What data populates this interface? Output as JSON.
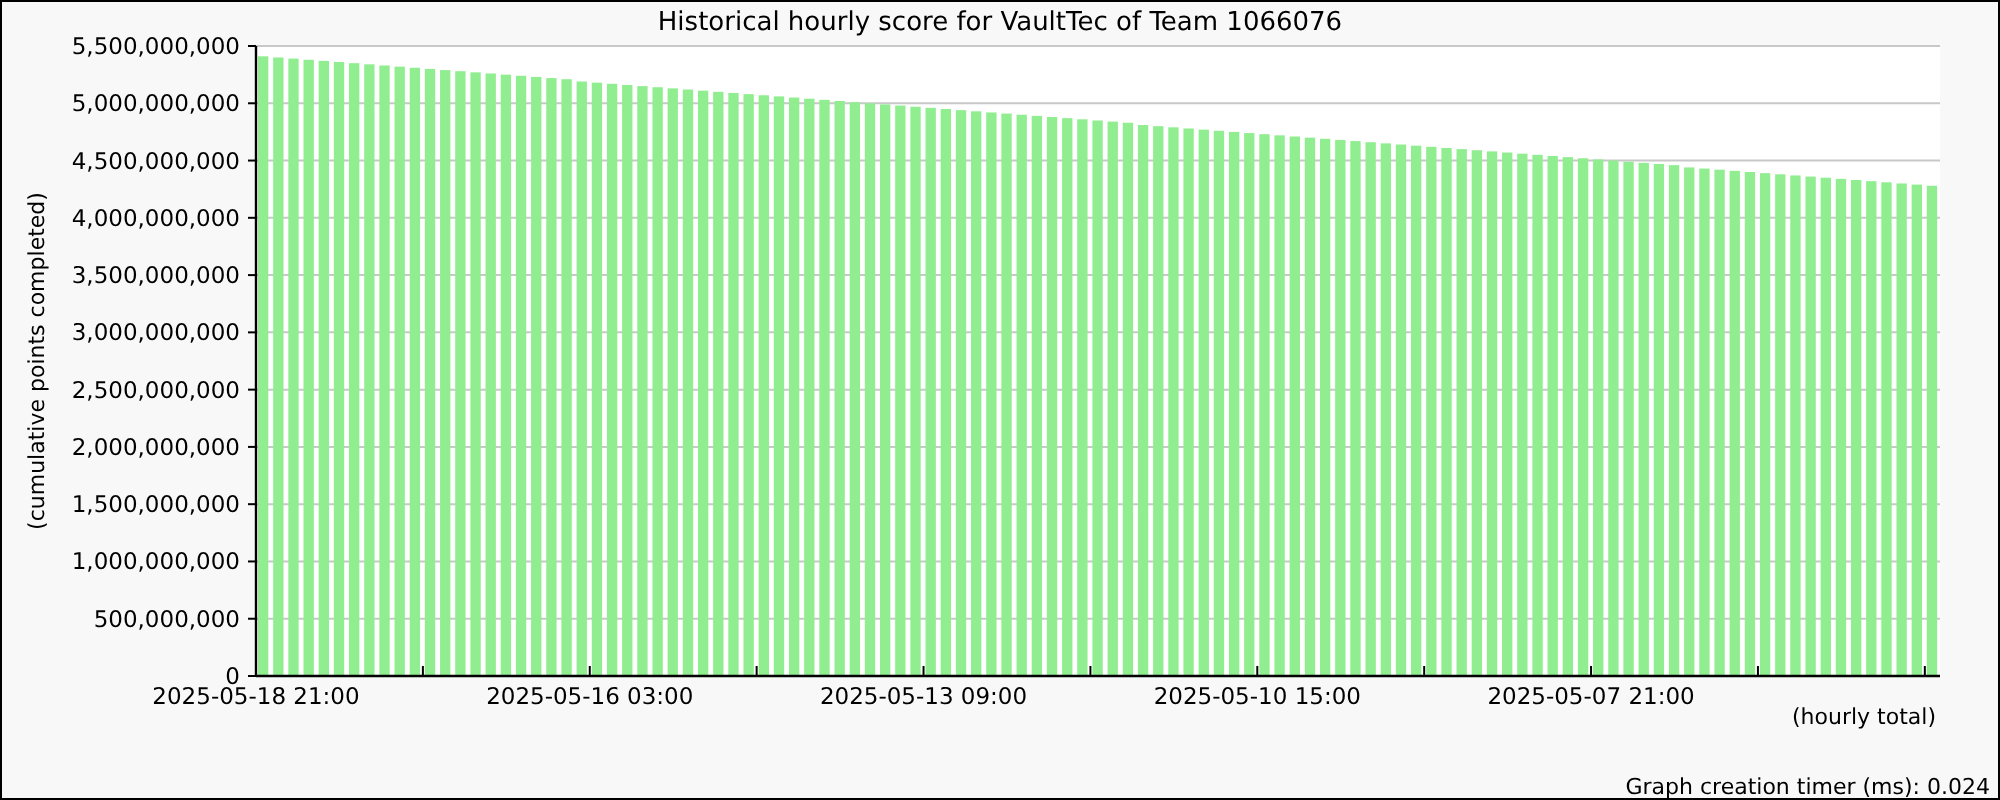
{
  "chart": {
    "chart_data": {
      "type": "bar",
      "title": "Historical hourly score for VaultTec of Team 1066076",
      "xlabel": "(hourly total)",
      "ylabel": "(cumulative points completed)",
      "categories": [
        "2025-05-18 21:00",
        null,
        null,
        null,
        null,
        null,
        null,
        null,
        null,
        null,
        null,
        null,
        null,
        null,
        null,
        null,
        null,
        null,
        null,
        null,
        null,
        null,
        "2025-05-16 03:00",
        null,
        null,
        null,
        null,
        null,
        null,
        null,
        null,
        null,
        null,
        null,
        null,
        null,
        null,
        null,
        null,
        null,
        null,
        null,
        null,
        null,
        "2025-05-13 09:00",
        null,
        null,
        null,
        null,
        null,
        null,
        null,
        null,
        null,
        null,
        null,
        null,
        null,
        null,
        null,
        null,
        null,
        null,
        null,
        null,
        null,
        "2025-05-10 15:00",
        null,
        null,
        null,
        null,
        null,
        null,
        null,
        null,
        null,
        null,
        null,
        null,
        null,
        null,
        null,
        null,
        null,
        null,
        null,
        null,
        null,
        "2025-05-07 21:00",
        null,
        null,
        null,
        null,
        null,
        null,
        null,
        null,
        null,
        null,
        null,
        null,
        null,
        null,
        null,
        null,
        null,
        null,
        null,
        null,
        null,
        null
      ],
      "values": [
        5410000000,
        5400000000,
        5390000000,
        5380000000,
        5370000000,
        5360000000,
        5350000000,
        5340000000,
        5330000000,
        5320000000,
        5310000000,
        5300000000,
        5290000000,
        5280000000,
        5270000000,
        5260000000,
        5250000000,
        5240000000,
        5230000000,
        5220000000,
        5210000000,
        5190000000,
        5180000000,
        5170000000,
        5160000000,
        5150000000,
        5140000000,
        5130000000,
        5120000000,
        5110000000,
        5100000000,
        5090000000,
        5080000000,
        5070000000,
        5060000000,
        5050000000,
        5040000000,
        5030000000,
        5020000000,
        5010000000,
        5000000000,
        4990000000,
        4980000000,
        4970000000,
        4960000000,
        4950000000,
        4940000000,
        4930000000,
        4920000000,
        4910000000,
        4900000000,
        4890000000,
        4880000000,
        4870000000,
        4860000000,
        4850000000,
        4840000000,
        4830000000,
        4810000000,
        4800000000,
        4790000000,
        4780000000,
        4770000000,
        4760000000,
        4750000000,
        4740000000,
        4730000000,
        4720000000,
        4710000000,
        4700000000,
        4690000000,
        4680000000,
        4670000000,
        4660000000,
        4650000000,
        4640000000,
        4630000000,
        4620000000,
        4610000000,
        4600000000,
        4590000000,
        4580000000,
        4570000000,
        4560000000,
        4550000000,
        4540000000,
        4530000000,
        4520000000,
        4510000000,
        4500000000,
        4490000000,
        4480000000,
        4470000000,
        4460000000,
        4440000000,
        4430000000,
        4420000000,
        4410000000,
        4400000000,
        4390000000,
        4380000000,
        4370000000,
        4360000000,
        4350000000,
        4340000000,
        4330000000,
        4320000000,
        4310000000,
        4300000000,
        4290000000,
        4280000000
      ],
      "ylim": [
        0,
        5500000000
      ],
      "grid": true,
      "yticks": [
        {
          "value": 0,
          "label": "0"
        },
        {
          "value": 500000000,
          "label": "500,000,000"
        },
        {
          "value": 1000000000,
          "label": "1,000,000,000"
        },
        {
          "value": 1500000000,
          "label": "1,500,000,000"
        },
        {
          "value": 2000000000,
          "label": "2,000,000,000"
        },
        {
          "value": 2500000000,
          "label": "2,500,000,000"
        },
        {
          "value": 3000000000,
          "label": "3,000,000,000"
        },
        {
          "value": 3500000000,
          "label": "3,500,000,000"
        },
        {
          "value": 4000000000,
          "label": "4,000,000,000"
        },
        {
          "value": 4500000000,
          "label": "4,500,000,000"
        },
        {
          "value": 5000000000,
          "label": "5,000,000,000"
        },
        {
          "value": 5500000000,
          "label": "5,500,000,000"
        }
      ]
    }
  },
  "footer": {
    "timer": "Graph creation timer (ms): 0.024"
  }
}
